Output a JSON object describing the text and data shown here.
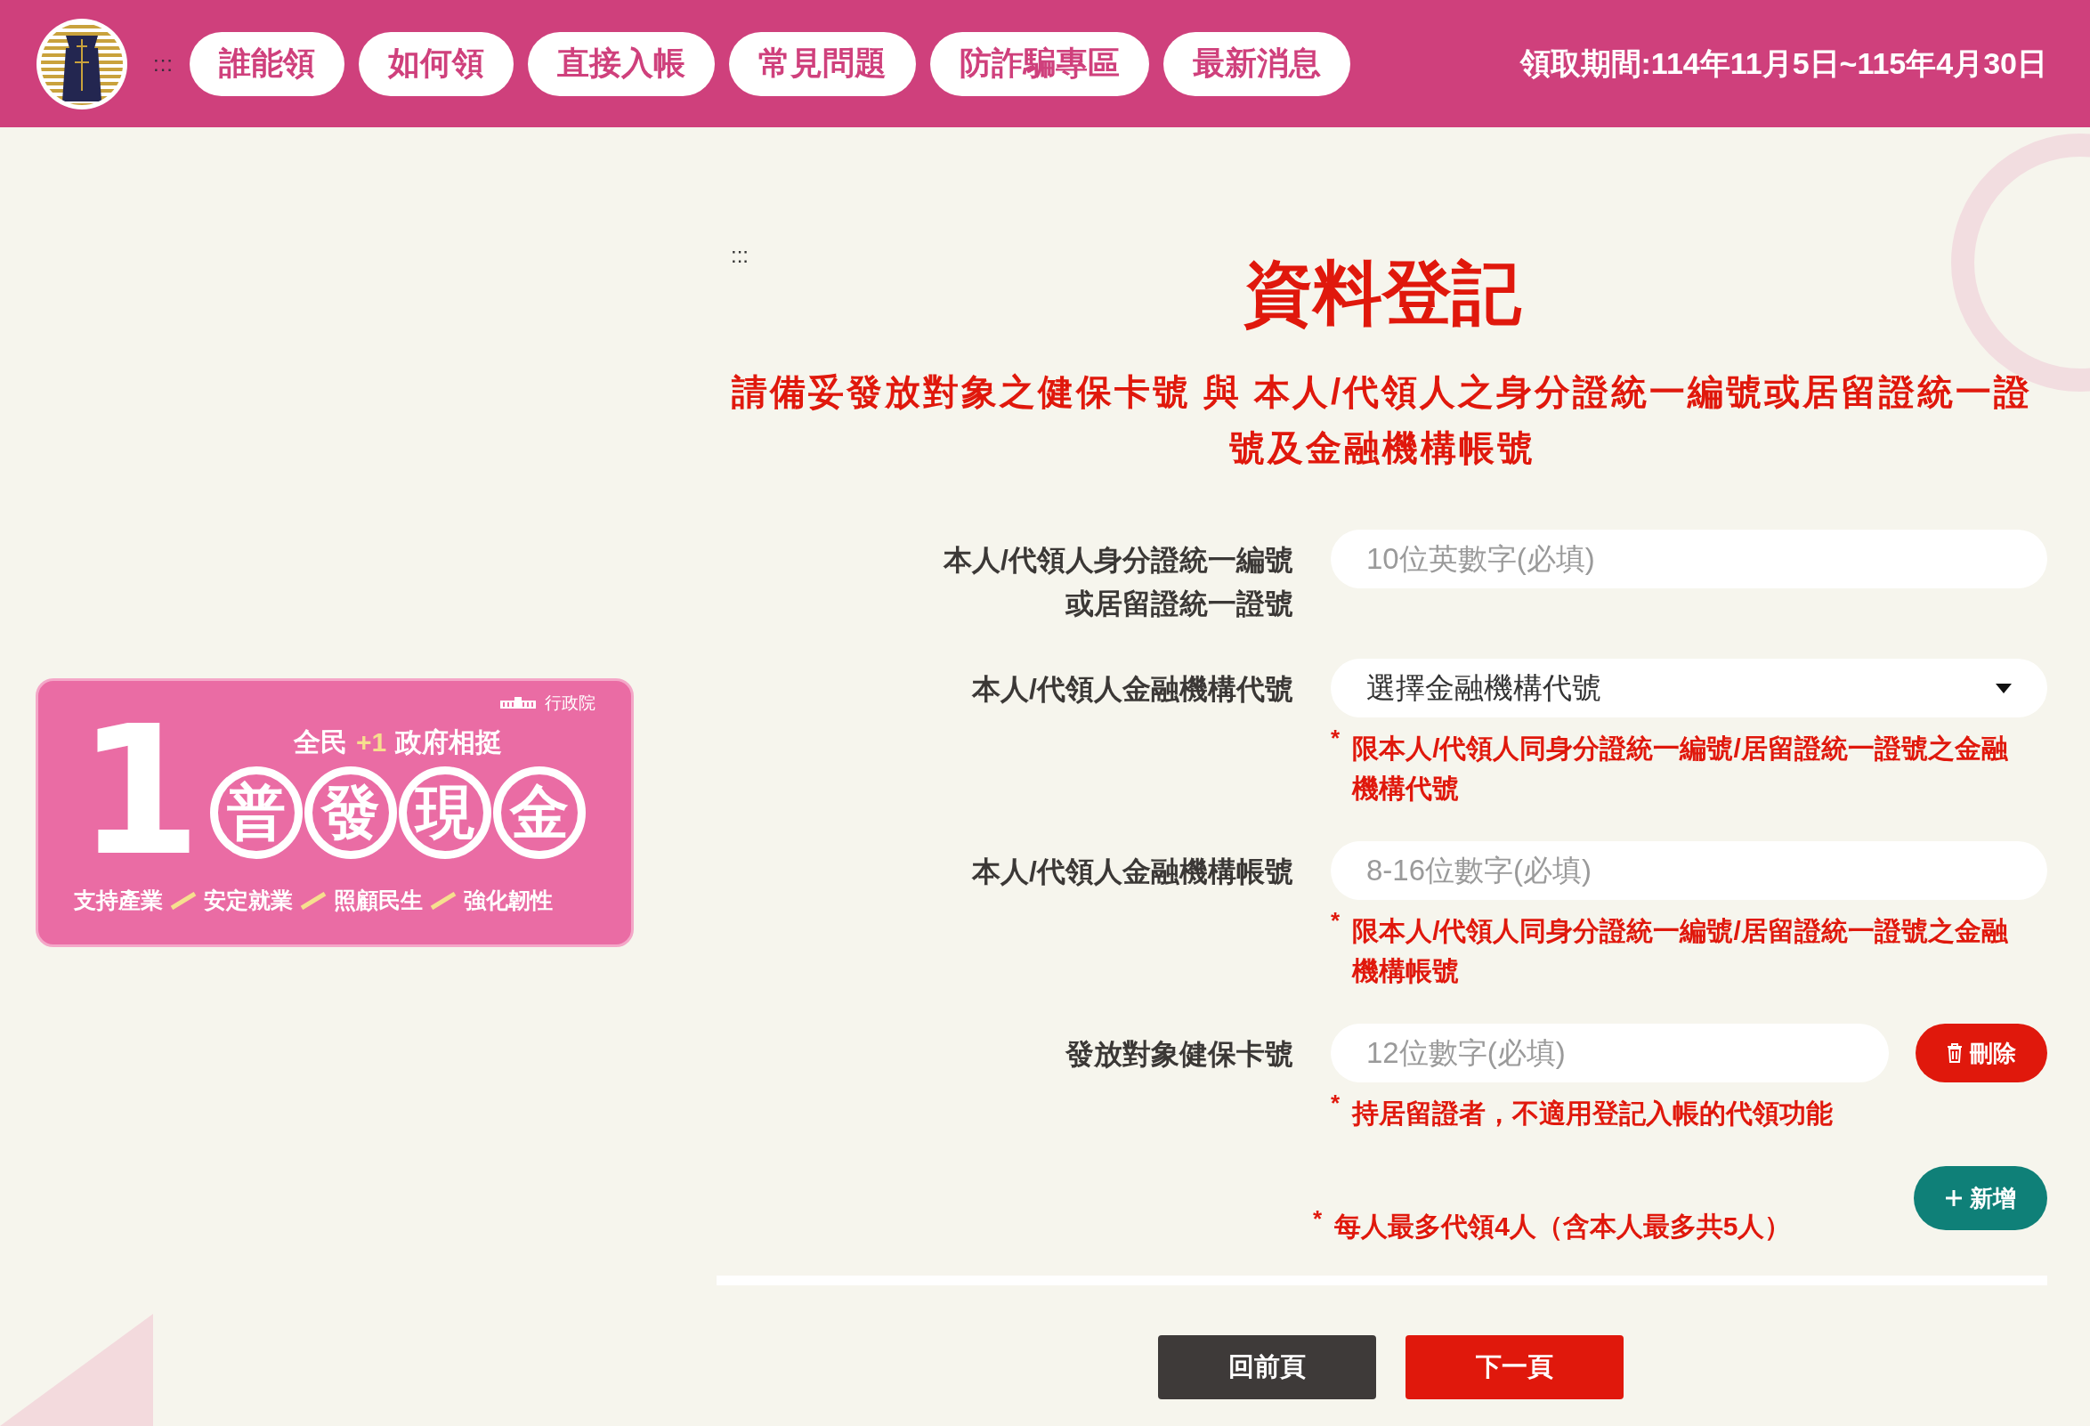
{
  "header": {
    "marker": ":::",
    "nav_items": [
      {
        "label": "誰能領"
      },
      {
        "label": "如何領"
      },
      {
        "label": "直接入帳"
      },
      {
        "label": "常見問題"
      },
      {
        "label": "防詐騙專區"
      },
      {
        "label": "最新消息"
      }
    ],
    "period": "領取期間:114年11月5日~115年4月30日"
  },
  "banner": {
    "agency": "行政院",
    "big_number": "1",
    "tagline": {
      "before": "全民",
      "plus": "+1",
      "after": "政府相挺"
    },
    "circled_chars": [
      "普",
      "發",
      "現",
      "金"
    ],
    "pillars": [
      "支持產業",
      "安定就業",
      "照顧民生",
      "強化韌性"
    ]
  },
  "form": {
    "marker": ":::",
    "title": "資料登記",
    "instructions": "請備妥發放對象之健保卡號 與 本人/代領人之身分證統一編號或居留證統一證號及金融機構帳號",
    "fields": [
      {
        "kind": "input",
        "label_lines": [
          "本人/代領人身分證統一編號",
          "或居留證統一證號"
        ],
        "placeholder": "10位英數字(必填)"
      },
      {
        "kind": "select",
        "label": "本人/代領人金融機構代號",
        "value": "選擇金融機構代號",
        "note_mark": "*",
        "note": "限本人/代領人同身分證統一編號/居留證統一證號之金融機構代號"
      },
      {
        "kind": "input",
        "label": "本人/代領人金融機構帳號",
        "placeholder": "8-16位數字(必填)",
        "note_mark": "*",
        "note": "限本人/代領人同身分證統一編號/居留證統一證號之金融機構帳號"
      },
      {
        "kind": "input",
        "label": "發放對象健保卡號",
        "placeholder": "12位數字(必填)",
        "delete_button": "刪除",
        "note_mark": "*",
        "note": "持居留證者，不適用登記入帳的代領功能"
      }
    ],
    "add_button": "新增",
    "limit_mark": "*",
    "limit_note": "每人最多代領4人（含本人最多共5人）",
    "buttons": [
      {
        "kind": "secondary",
        "label": "回前頁"
      },
      {
        "kind": "primary",
        "label": "下一頁"
      }
    ]
  }
}
